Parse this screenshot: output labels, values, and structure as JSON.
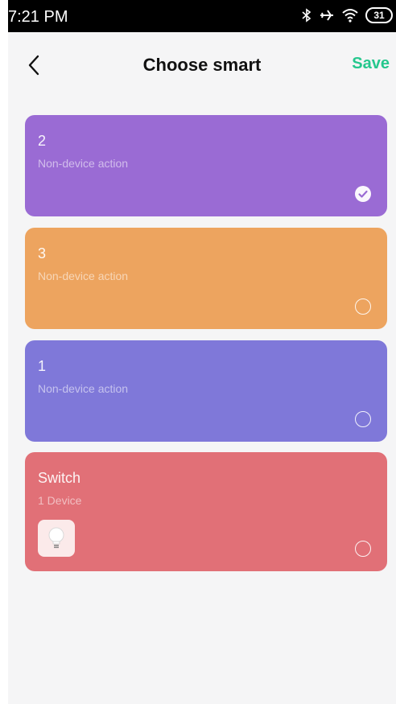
{
  "status_bar": {
    "time": "7:21 PM",
    "icons": [
      "bluetooth-icon",
      "airplane-icon",
      "wifi-icon",
      "battery-icon"
    ],
    "battery_level": "31"
  },
  "header": {
    "title": "Choose smart",
    "save_label": "Save",
    "back_icon": "chevron-left-icon"
  },
  "colors": {
    "accent": "#25c78d",
    "card_purple": "#9a6bd4",
    "card_orange": "#eda45f",
    "card_indigo": "#7f78d9",
    "card_red": "#e17077"
  },
  "cards": [
    {
      "name": "2",
      "subtitle": "Non-device action",
      "selected": true
    },
    {
      "name": "3",
      "subtitle": "Non-device action",
      "selected": false
    },
    {
      "name": "1",
      "subtitle": "Non-device action",
      "selected": false
    },
    {
      "name": "Switch",
      "subtitle": "1 Device",
      "selected": false,
      "device_icon": "lightbulb-icon"
    }
  ]
}
